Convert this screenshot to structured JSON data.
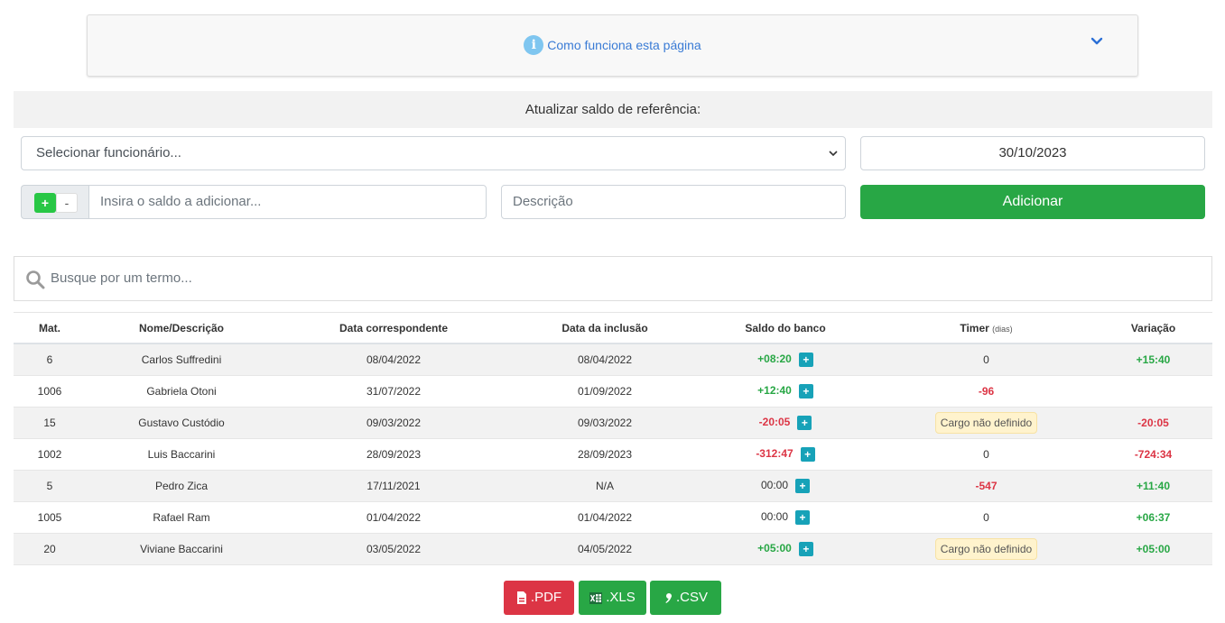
{
  "info": {
    "title": "Como funciona esta página"
  },
  "form": {
    "header": "Atualizar saldo de referência:",
    "employee_placeholder": "Selecionar funcionário...",
    "date": "30/10/2023",
    "toggle_plus": "+",
    "toggle_minus": "-",
    "saldo_placeholder": "Insira o saldo a adicionar...",
    "descricao_placeholder": "Descrição",
    "add_label": "Adicionar"
  },
  "search": {
    "placeholder": "Busque por um termo..."
  },
  "table": {
    "headers": {
      "mat": "Mat.",
      "nome": "Nome/Descrição",
      "data_corr": "Data correspondente",
      "data_incl": "Data da inclusão",
      "saldo": "Saldo do banco",
      "timer": "Timer",
      "timer_unit": "(dias)",
      "variacao": "Variação"
    },
    "rows": [
      {
        "mat": "6",
        "nome": "Carlos Suffredini",
        "data_corr": "08/04/2022",
        "data_incl": "08/04/2022",
        "saldo": "+08:20",
        "timer": "0",
        "variacao": "+15:40"
      },
      {
        "mat": "1006",
        "nome": "Gabriela Otoni",
        "data_corr": "31/07/2022",
        "data_incl": "01/09/2022",
        "saldo": "+12:40",
        "timer": "-96",
        "variacao": ""
      },
      {
        "mat": "15",
        "nome": "Gustavo Custódio",
        "data_corr": "09/03/2022",
        "data_incl": "09/03/2022",
        "saldo": "-20:05",
        "timer": "Cargo não definido",
        "variacao": "-20:05"
      },
      {
        "mat": "1002",
        "nome": "Luis Baccarini",
        "data_corr": "28/09/2023",
        "data_incl": "28/09/2023",
        "saldo": "-312:47",
        "timer": "0",
        "variacao": "-724:34"
      },
      {
        "mat": "5",
        "nome": "Pedro Zica",
        "data_corr": "17/11/2021",
        "data_incl": "N/A",
        "saldo": "00:00",
        "timer": "-547",
        "variacao": "+11:40"
      },
      {
        "mat": "1005",
        "nome": "Rafael Ram",
        "data_corr": "01/04/2022",
        "data_incl": "01/04/2022",
        "saldo": "00:00",
        "timer": "0",
        "variacao": "+06:37"
      },
      {
        "mat": "20",
        "nome": "Viviane Baccarini",
        "data_corr": "03/05/2022",
        "data_incl": "04/05/2022",
        "saldo": "+05:00",
        "timer": "Cargo não definido",
        "variacao": "+05:00"
      }
    ],
    "add_symbol": "+"
  },
  "export": {
    "pdf": ".PDF",
    "xls": ".XLS",
    "csv": ".CSV"
  },
  "colors": {
    "accent": "#28a745",
    "danger": "#dc3545",
    "info": "#17a2b8",
    "link": "#3a7bd5",
    "badge_bg": "#fff3cd"
  }
}
